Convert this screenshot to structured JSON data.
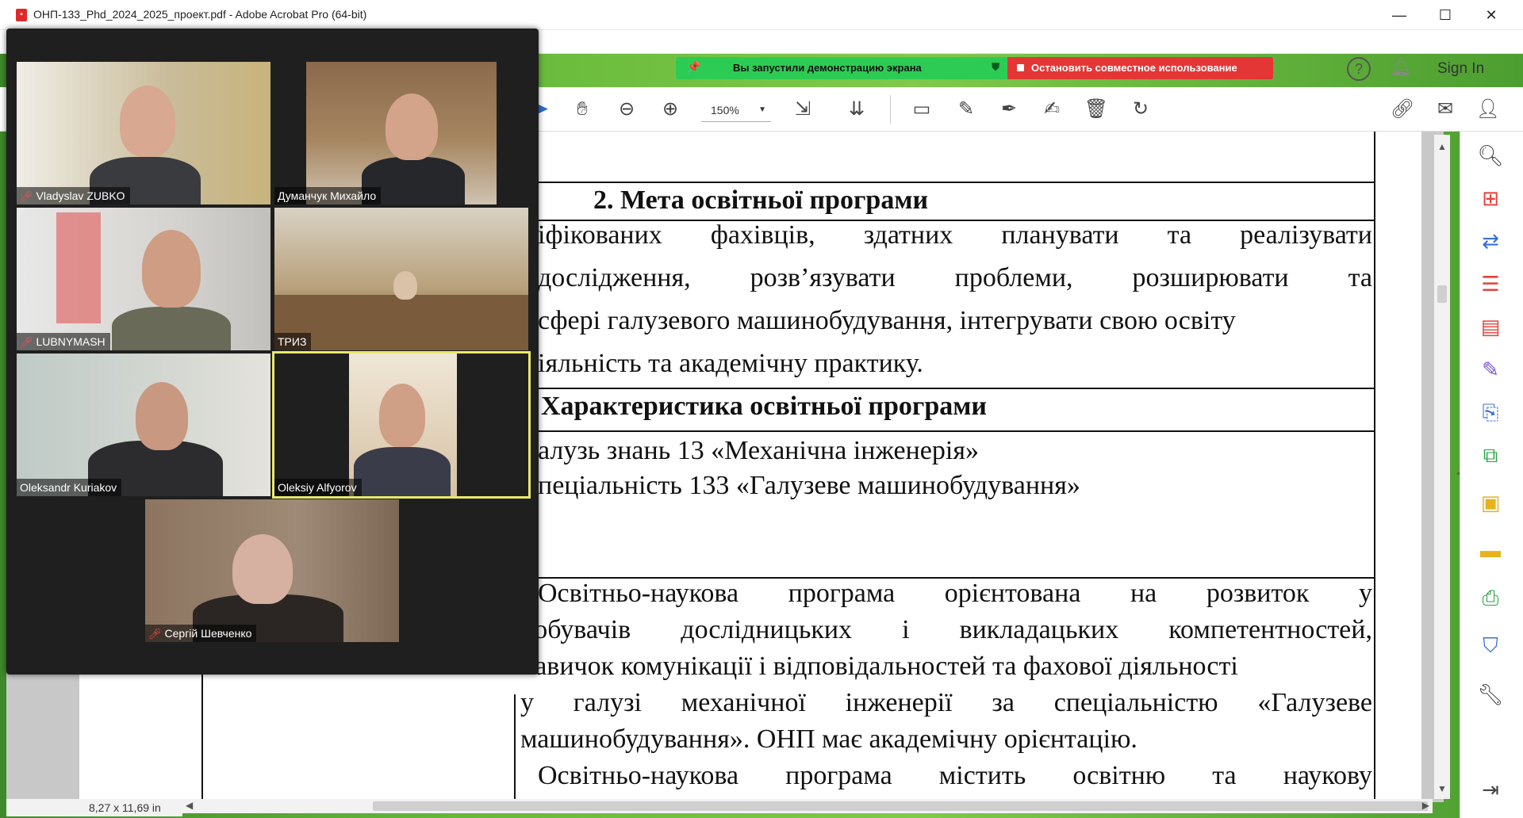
{
  "window": {
    "title": "ОНП-133_Phd_2024_2025_проект.pdf - Adobe Acrobat Pro (64-bit)",
    "controls": {
      "minimize": "—",
      "maximize": "☐",
      "close": "✕"
    }
  },
  "share_banner": {
    "status": "Вы запустили демонстрацию экрана",
    "stop": "Остановить совместное использование"
  },
  "header": {
    "help": "?",
    "signin": "Sign In"
  },
  "toolbar": {
    "zoom": "150%"
  },
  "document": {
    "heading1": "2. Мета освітньої програми",
    "goal_lines": [
      [
        "іфікованих",
        "фахівців,",
        "здатних",
        "планувати",
        "та",
        "реалізувати"
      ],
      [
        "дослідження,",
        "розв’язувати",
        "проблеми,",
        "розширювати",
        "та"
      ],
      [
        "сфері галузевого машинобудування, інтегрувати свою освіту"
      ],
      [
        "іяльність та  академічну практику."
      ]
    ],
    "heading2": "Характеристика освітньої програми",
    "field_line1": "алузь знань 13 «Механічна інженерія»",
    "field_line2": "пеціальність 133 «Галузеве машинобудування»",
    "focus_lines": [
      [
        "Освітньо-наукова",
        "програма",
        "орієнтована",
        "на",
        "розвиток",
        "у"
      ],
      [
        "добувачів",
        "дослідницьких",
        "і",
        "викладацьких",
        "компетентностей,"
      ],
      [
        "навичок комунікації і відповідальностей та фахової діяльності"
      ],
      [
        "у",
        "галузі",
        "механічної",
        "інженерії",
        "за",
        "спеціальністю",
        "«Галузеве"
      ],
      [
        "машинобудування». ОНП має академічну орієнтацію."
      ],
      [
        "Освітньо-наукова",
        "програма",
        "містить",
        "освітню",
        "та",
        "наукову"
      ]
    ],
    "page_size": "8,27 x 11,69 in"
  },
  "meeting": {
    "participants": [
      {
        "name": "Vladyslav ZUBKO",
        "muted": true
      },
      {
        "name": "Думанчук Михайло",
        "muted": false
      },
      {
        "name": "LUBNYMASH",
        "muted": true
      },
      {
        "name": "ТРИЗ",
        "muted": false
      },
      {
        "name": "Oleksandr Kuriakov",
        "muted": false
      },
      {
        "name": "Oleksiy Alfyorov",
        "muted": false,
        "active_speaker": true
      },
      {
        "name": "Сергій Шевченко",
        "muted": true
      }
    ]
  },
  "colors": {
    "share_green": "#2ccc54",
    "share_red": "#e53636",
    "active_speaker": "#e8e86a",
    "rail_red": "#e5413a",
    "rail_blue": "#3c6fd6",
    "rail_green": "#2aa245",
    "rail_yellow": "#e8b21c",
    "rail_purple": "#7a4fd6"
  }
}
